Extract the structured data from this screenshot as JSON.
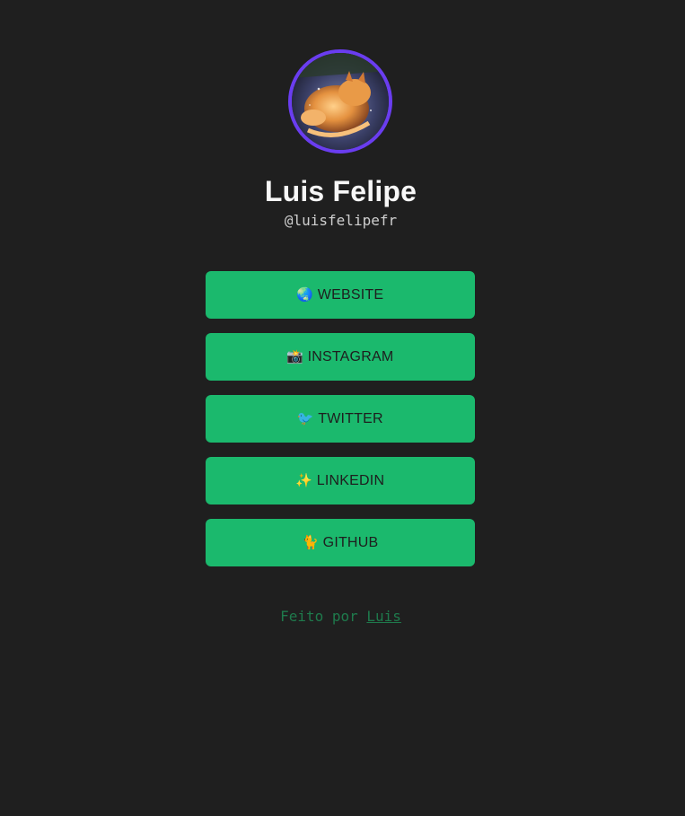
{
  "profile": {
    "name": "Luis Felipe",
    "handle": "@luisfelipefr",
    "avatar_alt": "sleeping-cat-illustration"
  },
  "links": [
    {
      "emoji": "🌏",
      "label": "WEBSITE",
      "icon": "globe-icon"
    },
    {
      "emoji": "📸",
      "label": "INSTAGRAM",
      "icon": "camera-icon"
    },
    {
      "emoji": "🐦",
      "label": "TWITTER",
      "icon": "bird-icon"
    },
    {
      "emoji": "✨",
      "label": "LINKEDIN",
      "icon": "sparkles-icon"
    },
    {
      "emoji": "🐈",
      "label": "GITHUB",
      "icon": "cat-icon"
    }
  ],
  "footer": {
    "text": "Feito por",
    "link_label": "Luis"
  },
  "colors": {
    "background": "#1f1f1f",
    "button": "#1bb96d",
    "avatar_ring": "#6a3df0",
    "footer_text": "#1f7a4c"
  }
}
